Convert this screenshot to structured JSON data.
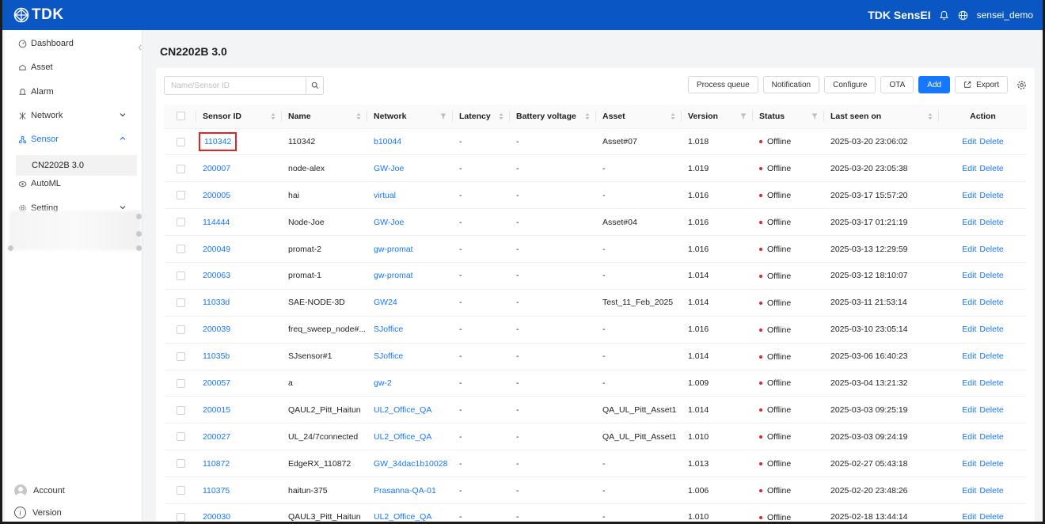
{
  "topbar": {
    "logo_text": "TDK",
    "app_name": "TDK SensEI",
    "user_name": "sensei_demo",
    "icons": {
      "logo": "tdk-logo-icon",
      "bell": "bell-icon",
      "globe": "globe-icon"
    }
  },
  "sidebar": {
    "items": [
      {
        "label": "Dashboard",
        "icon": "dashboard-icon"
      },
      {
        "label": "Asset",
        "icon": "asset-icon"
      },
      {
        "label": "Alarm",
        "icon": "bell-icon"
      },
      {
        "label": "Network",
        "icon": "network-icon",
        "expandable": true
      },
      {
        "label": "Sensor",
        "icon": "sensor-icon",
        "expandable": true,
        "expanded": true,
        "active": true
      },
      {
        "label": "AutoML",
        "icon": "automl-icon"
      },
      {
        "label": "Setting",
        "icon": "gear-icon",
        "expandable": true
      }
    ],
    "sub_item": "CN2202B 3.0",
    "account_label": "Account",
    "version_label": "Version"
  },
  "page": {
    "title": "CN2202B 3.0"
  },
  "search": {
    "placeholder": "Name/Sensor ID",
    "value": ""
  },
  "toolbar": {
    "process_queue": "Process queue",
    "notification": "Notification",
    "configure": "Configure",
    "ota": "OTA",
    "add": "Add",
    "export": "Export"
  },
  "colors": {
    "brand": "#0a56c2",
    "primary": "#1677ff",
    "offline": "#e02424",
    "highlight": "#e02424"
  },
  "table": {
    "columns": [
      "Sensor ID",
      "Name",
      "Network",
      "Latency",
      "Battery voltage",
      "Asset",
      "Version",
      "Status",
      "Last seen on",
      "Action"
    ],
    "edit_label": "Edit",
    "delete_label": "Delete",
    "rows": [
      {
        "sensor_id": "110342",
        "name": "110342",
        "network": "b10044",
        "latency": "-",
        "battery": "-",
        "asset": "Asset#07",
        "version": "1.018",
        "status": "Offline",
        "last_seen": "2025-03-20 23:06:02",
        "highlighted": true
      },
      {
        "sensor_id": "200007",
        "name": "node-alex",
        "network": "GW-Joe",
        "latency": "-",
        "battery": "-",
        "asset": "-",
        "version": "1.019",
        "status": "Offline",
        "last_seen": "2025-03-20 23:05:38"
      },
      {
        "sensor_id": "200005",
        "name": "hai",
        "network": "virtual",
        "latency": "-",
        "battery": "-",
        "asset": "-",
        "version": "1.016",
        "status": "Offline",
        "last_seen": "2025-03-17 15:57:20"
      },
      {
        "sensor_id": "114444",
        "name": "Node-Joe",
        "network": "GW-Joe",
        "latency": "-",
        "battery": "-",
        "asset": "Asset#04",
        "version": "1.016",
        "status": "Offline",
        "last_seen": "2025-03-17 01:21:19"
      },
      {
        "sensor_id": "200049",
        "name": "promat-2",
        "network": "gw-promat",
        "latency": "-",
        "battery": "-",
        "asset": "-",
        "version": "1.016",
        "status": "Offline",
        "last_seen": "2025-03-13 12:29:59"
      },
      {
        "sensor_id": "200063",
        "name": "promat-1",
        "network": "gw-promat",
        "latency": "-",
        "battery": "-",
        "asset": "-",
        "version": "1.014",
        "status": "Offline",
        "last_seen": "2025-03-12 18:10:07"
      },
      {
        "sensor_id": "11033d",
        "name": "SAE-NODE-3D",
        "network": "GW24",
        "latency": "-",
        "battery": "-",
        "asset": "Test_11_Feb_2025",
        "version": "1.014",
        "status": "Offline",
        "last_seen": "2025-03-11 21:53:14"
      },
      {
        "sensor_id": "200039",
        "name": "freq_sweep_node#...",
        "network": "SJoffice",
        "latency": "-",
        "battery": "-",
        "asset": "-",
        "version": "1.016",
        "status": "Offline",
        "last_seen": "2025-03-10 23:05:14"
      },
      {
        "sensor_id": "11035b",
        "name": "SJsensor#1",
        "network": "SJoffice",
        "latency": "-",
        "battery": "-",
        "asset": "-",
        "version": "1.014",
        "status": "Offline",
        "last_seen": "2025-03-06 16:40:23"
      },
      {
        "sensor_id": "200057",
        "name": "a",
        "network": "gw-2",
        "latency": "-",
        "battery": "-",
        "asset": "-",
        "version": "1.009",
        "status": "Offline",
        "last_seen": "2025-03-04 13:21:32"
      },
      {
        "sensor_id": "200015",
        "name": "QAUL2_Pitt_Haitun",
        "network": "UL2_Office_QA",
        "latency": "-",
        "battery": "-",
        "asset": "QA_UL_Pitt_Asset1",
        "version": "1.014",
        "status": "Offline",
        "last_seen": "2025-03-03 09:25:19"
      },
      {
        "sensor_id": "200027",
        "name": "UL_24/7connected",
        "network": "UL2_Office_QA",
        "latency": "-",
        "battery": "-",
        "asset": "QA_UL_Pitt_Asset1",
        "version": "1.010",
        "status": "Offline",
        "last_seen": "2025-03-03 09:24:19"
      },
      {
        "sensor_id": "110872",
        "name": "EdgeRX_110872",
        "network": "GW_34dac1b10028",
        "latency": "-",
        "battery": "-",
        "asset": "-",
        "version": "1.013",
        "status": "Offline",
        "last_seen": "2025-02-27 05:43:18"
      },
      {
        "sensor_id": "110375",
        "name": "haitun-375",
        "network": "Prasanna-QA-01",
        "latency": "-",
        "battery": "-",
        "asset": "-",
        "version": "1.006",
        "status": "Offline",
        "last_seen": "2025-02-20 23:48:26"
      },
      {
        "sensor_id": "200030",
        "name": "QAUL3_Pitt_Haitun",
        "network": "UL2_Office_QA",
        "latency": "-",
        "battery": "-",
        "asset": "-",
        "version": "1.010",
        "status": "Offline",
        "last_seen": "2025-02-18 13:44:14"
      }
    ]
  }
}
